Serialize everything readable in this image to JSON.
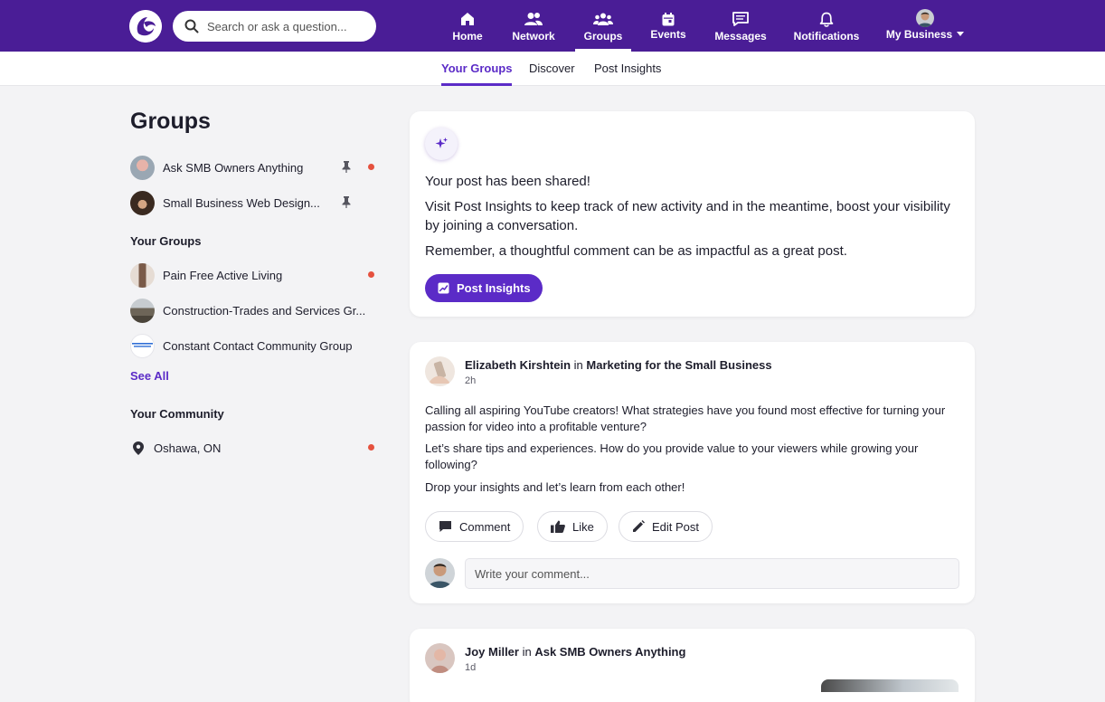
{
  "header": {
    "search_placeholder": "Search or ask a question...",
    "nav": [
      {
        "label": "Home",
        "icon": "home-icon"
      },
      {
        "label": "Network",
        "icon": "network-icon"
      },
      {
        "label": "Groups",
        "icon": "groups-icon",
        "active": true
      },
      {
        "label": "Events",
        "icon": "events-icon"
      },
      {
        "label": "Messages",
        "icon": "messages-icon"
      },
      {
        "label": "Notifications",
        "icon": "bell-icon"
      },
      {
        "label": "My Business",
        "icon": "avatar"
      }
    ],
    "accent": "#4a1d96"
  },
  "subnav": {
    "tabs": [
      {
        "label": "Your Groups",
        "active": true
      },
      {
        "label": "Discover"
      },
      {
        "label": "Post Insights"
      }
    ]
  },
  "sidebar": {
    "title": "Groups",
    "pinned": [
      {
        "label": "Ask SMB Owners Anything",
        "pinned": true,
        "unread": true
      },
      {
        "label": "Small Business Web Design...",
        "pinned": true,
        "unread": false
      }
    ],
    "your_groups_heading": "Your Groups",
    "your_groups": [
      {
        "label": "Pain Free Active Living",
        "unread": true
      },
      {
        "label": "Construction-Trades and Services Gr...",
        "unread": false
      },
      {
        "label": "Constant Contact Community Group",
        "unread": false
      }
    ],
    "see_all": "See All",
    "community_heading": "Your Community",
    "community": [
      {
        "label": "Oshawa, ON",
        "icon": "location-pin-icon",
        "unread": true
      }
    ]
  },
  "shared_card": {
    "title": "Your post has been shared!",
    "line1": "Visit Post Insights to keep track of new activity and in the meantime, boost your visibility by joining a conversation.",
    "line2": "Remember, a thoughtful comment can be as impactful as a great post.",
    "button": "Post Insights"
  },
  "post1": {
    "author": "Elizabeth Kirshtein",
    "in_word": "in",
    "group": "Marketing for the Small Business",
    "time": "2h",
    "p1": "Calling all aspiring YouTube creators! What strategies have you found most effective for turning your passion for video into a profitable venture?",
    "p2": "Let’s share tips and experiences. How do you provide value to your viewers while growing your following?",
    "p3": "Drop your insights and let’s learn from each other!",
    "comment_label": "Comment",
    "like_label": "Like",
    "edit_label": "Edit Post",
    "comment_placeholder": "Write your comment..."
  },
  "post2": {
    "author": "Joy Miller",
    "in_word": "in",
    "group": "Ask SMB Owners Anything",
    "time": "1d"
  }
}
